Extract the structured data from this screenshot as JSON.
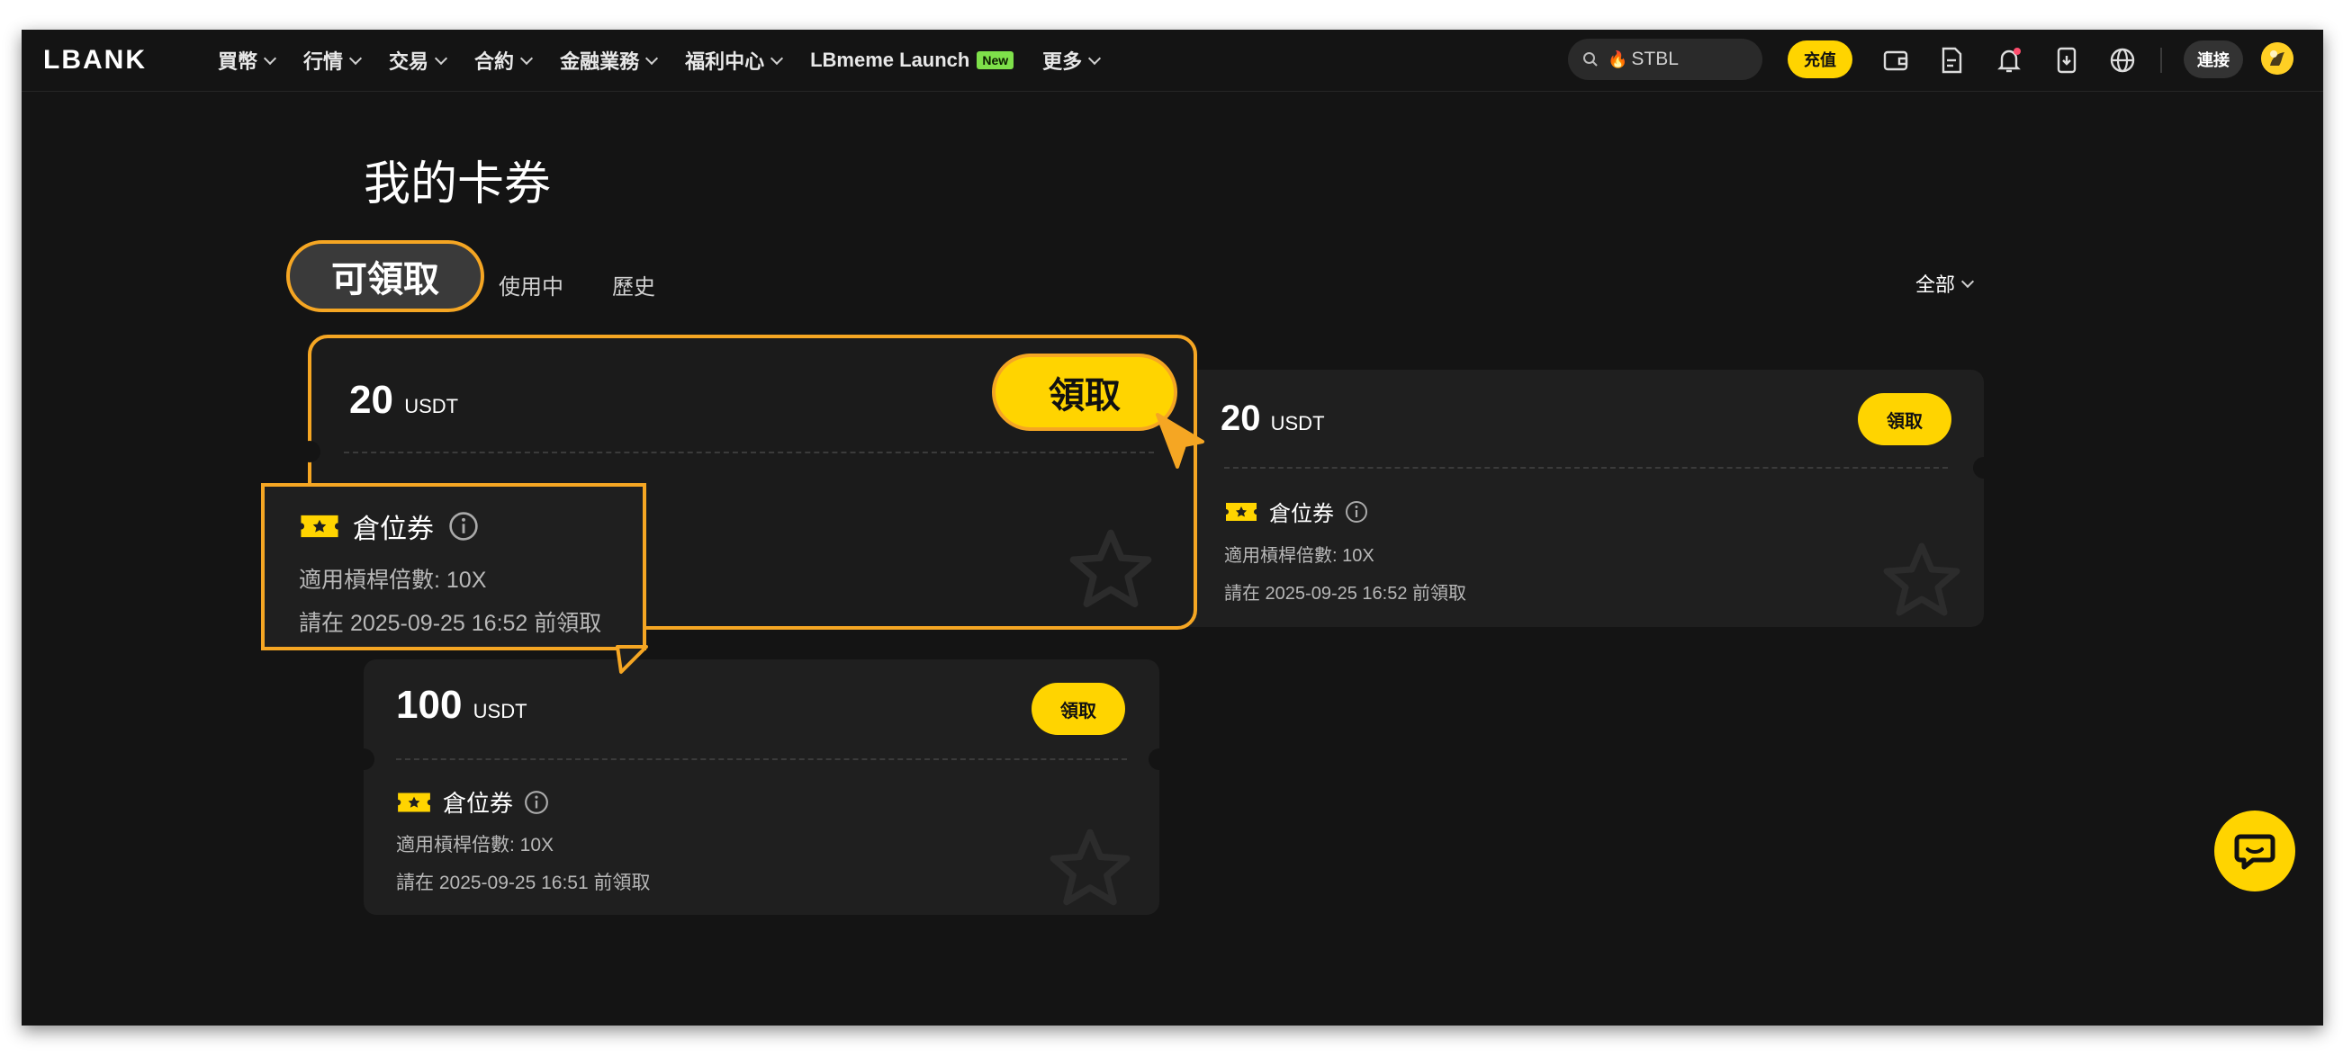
{
  "nav": {
    "logo": "LBANK",
    "menu": [
      {
        "label": "買幣",
        "chevron": true
      },
      {
        "label": "行情",
        "chevron": true
      },
      {
        "label": "交易",
        "chevron": true
      },
      {
        "label": "合約",
        "chevron": true
      },
      {
        "label": "金融業務",
        "chevron": true
      },
      {
        "label": "福利中心",
        "chevron": true
      },
      {
        "label": "LBmeme Launch",
        "chevron": false,
        "badge": "New"
      },
      {
        "label": "更多",
        "chevron": true
      }
    ],
    "search_value": "STBL",
    "deposit_label": "充值",
    "connect_label": "連接",
    "icons": [
      "wallet-icon",
      "document-icon",
      "bell-icon",
      "download-app-icon",
      "globe-icon"
    ]
  },
  "page": {
    "title": "我的卡券",
    "tabs": [
      "可領取",
      "使用中",
      "歷史"
    ],
    "filter_label": "全部"
  },
  "cards": [
    {
      "amount": "20",
      "unit": "USDT",
      "claim_label": "領取",
      "type": "倉位券",
      "leverage": "適用槓桿倍數: 10X",
      "deadline": "請在 2025-09-25 16:52 前領取"
    },
    {
      "amount": "20",
      "unit": "USDT",
      "claim_label": "領取",
      "type": "倉位券",
      "leverage": "適用槓桿倍數: 10X",
      "deadline": "請在 2025-09-25 16:52 前領取"
    },
    {
      "amount": "100",
      "unit": "USDT",
      "claim_label": "領取",
      "type": "倉位券",
      "leverage": "適用槓桿倍數: 10X",
      "deadline": "請在 2025-09-25 16:51 前領取"
    }
  ],
  "colors": {
    "background": "#141414",
    "card": "#1f1f1f",
    "accent": "#ffd400",
    "highlight": "#f5a623"
  }
}
